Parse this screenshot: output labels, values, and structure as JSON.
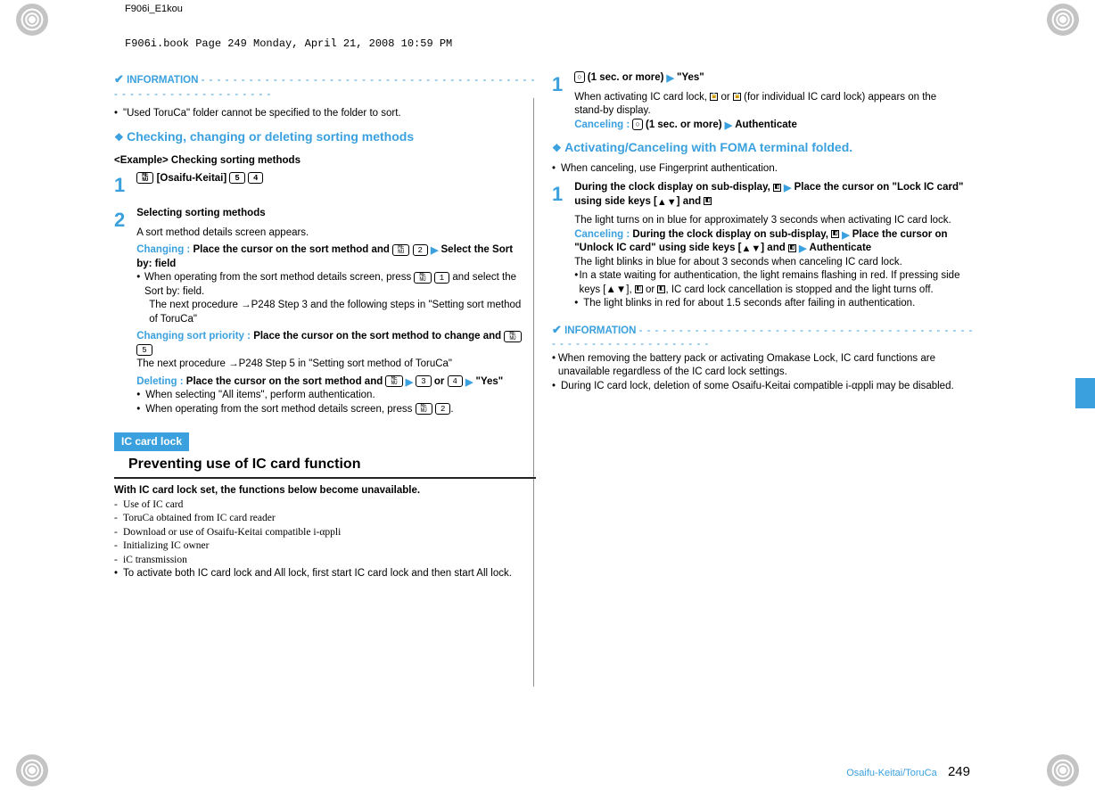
{
  "meta": {
    "doc_id": "F906i_E1kou",
    "page_stamp": "F906i.book  Page 249  Monday, April 21, 2008  10:59 PM"
  },
  "left": {
    "info_label": "INFORMATION",
    "info_bullet": "\"Used ToruCa\" folder cannot be specified to the folder to sort.",
    "heading_check": "Checking, changing or deleting sorting methods",
    "example_label": "<Example> Checking sorting methods",
    "step1": {
      "num": "1",
      "btn": "ME NU",
      "title_rest": " [Osaifu-Keitai] ",
      "k1": "5",
      "k2": "4"
    },
    "step2": {
      "num": "2",
      "title": "Selecting sorting methods",
      "line1": "A sort method details screen appears.",
      "changing_label": "Changing :",
      "changing_text": " Place the cursor on the sort method and ",
      "changing_btn": "ME NU",
      "changing_k": "2",
      "changing_end": " Select the Sort by: field",
      "b1a": "When operating from the sort method details screen, press ",
      "b1_btn": "ME NU",
      "b1_k": "1",
      "b1b": " and select the Sort by: field.",
      "b2": "The next procedure →P248 Step 3 and the following steps in \"Setting sort method of ToruCa\"",
      "csp_label": "Changing sort priority :",
      "csp_text": " Place the cursor on the sort method to change and ",
      "csp_btn": "ME NU",
      "csp_k": "5",
      "csp_next": "The next procedure →P248 Step 5 in \"Setting sort method of ToruCa\"",
      "del_label": "Deleting :",
      "del_text": " Place the cursor on the sort method and ",
      "del_btn": "ME NU",
      "del_k1": "3",
      "del_or": " or ",
      "del_k2": "4",
      "del_yes": "\"Yes\"",
      "b3": "When selecting \"All items\", perform authentication.",
      "b4a": "When operating from the sort method details screen, press ",
      "b4_btn": "ME NU",
      "b4_k": "2",
      "b4b": "."
    },
    "ic_lock_label": "IC card lock",
    "ic_lock_title": "Preventing use of IC card function",
    "ic_lock_intro": "With IC card lock set, the functions below become unavailable.",
    "ic_list": [
      "Use of IC card",
      "ToruCa obtained from IC card reader",
      "Download or use of Osaifu-Keitai compatible i-αppli",
      "Initializing IC owner",
      "iC transmission"
    ],
    "ic_note": "To activate both IC card lock and All lock, first start IC card lock and then start All lock."
  },
  "right": {
    "step1": {
      "num": "1",
      "key": "○",
      "title_a": " (1 sec. or more)",
      "title_b": "\"Yes\"",
      "line1a": "When activating IC card lock, ",
      "line1b": " or ",
      "line1c": " (for individual IC card lock) appears on the stand-by display.",
      "cancel_label": "Canceling :",
      "cancel_k": "○",
      "cancel_text": " (1 sec. or more)",
      "cancel_auth": "Authenticate"
    },
    "heading_act": "Activating/Canceling with FOMA terminal folded.",
    "cancel_fp": "When canceling, use Fingerprint authentication.",
    "step2": {
      "num": "1",
      "title_a": "During the clock display on sub-display, ",
      "title_b": "Place the cursor on \"Lock IC card\" using side keys [",
      "title_c": "] and ",
      "line1": "The light turns on in blue for approximately 3 seconds when activating IC card lock.",
      "cancel_label": "Canceling :",
      "cancel_a": " During the clock display on sub-display, ",
      "cancel_b": "Place the cursor on \"Unlock IC card\" using side keys [",
      "cancel_c": "] and ",
      "cancel_d": "Authenticate",
      "after": "The light blinks in blue for about 3 seconds when canceling IC card lock.",
      "b1": "In a state waiting for authentication, the light remains flashing in red. If pressing side keys [▲▼], ",
      "b1b": " or ",
      "b1c": ", IC card lock cancellation is stopped and the light turns off.",
      "b2": "The light blinks in red for about 1.5 seconds after failing in authentication."
    },
    "info_label": "INFORMATION",
    "info_b1": "When removing the battery pack or activating Omakase Lock, IC card functions are unavailable regardless of the IC card lock settings.",
    "info_b2": "During IC card lock, deletion of some Osaifu-Keitai compatible i-αppli may be disabled."
  },
  "footer": {
    "section": "Osaifu-Keitai/ToruCa",
    "page": "249"
  }
}
